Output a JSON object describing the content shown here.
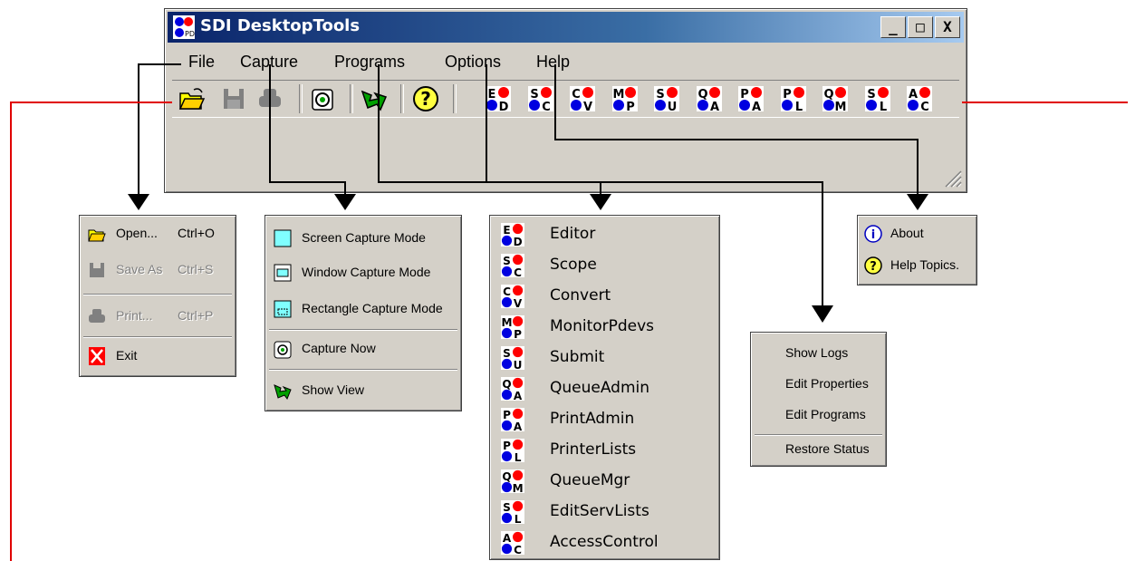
{
  "window": {
    "title": "SDI DesktopTools",
    "minimize": "_",
    "maximize": "□",
    "close": "X"
  },
  "menubar": [
    "File",
    "Capture",
    "Programs",
    "Options",
    "Help"
  ],
  "file_menu": {
    "open": {
      "label": "Open...",
      "shortcut": "Ctrl+O"
    },
    "save_as": {
      "label": "Save As",
      "shortcut": "Ctrl+S"
    },
    "print": {
      "label": "Print...",
      "shortcut": "Ctrl+P"
    },
    "exit": {
      "label": "Exit"
    }
  },
  "capture_menu": [
    "Screen Capture Mode",
    "Window Capture Mode",
    "Rectangle Capture Mode",
    "Capture Now",
    "Show View"
  ],
  "programs_menu": [
    {
      "label": "Editor",
      "top": "E",
      "bottom": "D"
    },
    {
      "label": "Scope",
      "top": "S",
      "bottom": "C"
    },
    {
      "label": "Convert",
      "top": "C",
      "bottom": "V"
    },
    {
      "label": "MonitorPdevs",
      "top": "M",
      "bottom": "P"
    },
    {
      "label": "Submit",
      "top": "S",
      "bottom": "U"
    },
    {
      "label": "QueueAdmin",
      "top": "Q",
      "bottom": "A"
    },
    {
      "label": "PrintAdmin",
      "top": "P",
      "bottom": "A"
    },
    {
      "label": "PrinterLists",
      "top": "P",
      "bottom": "L"
    },
    {
      "label": "QueueMgr",
      "top": "Q",
      "bottom": "M"
    },
    {
      "label": "EditServLists",
      "top": "S",
      "bottom": "L"
    },
    {
      "label": "AccessControl",
      "top": "A",
      "bottom": "C"
    }
  ],
  "options_menu": [
    "Show Logs",
    "Edit Properties",
    "Edit Programs",
    "Restore Status"
  ],
  "help_menu": [
    "About",
    "Help Topics."
  ],
  "colors": {
    "title_start": "#0a246a",
    "title_end": "#a6caf0",
    "annotation_red": "#e00000",
    "chrome": "#d4d0c8",
    "badge_red": "#ff0000",
    "badge_blue": "#0000e0"
  },
  "icons": {
    "open": "folder-open-icon",
    "save": "floppy-disk-icon",
    "print": "printer-icon",
    "capture": "camera-icon",
    "view": "arrow-view-icon",
    "help": "question-mark-icon",
    "exit": "red-x-icon",
    "about": "info-icon"
  }
}
